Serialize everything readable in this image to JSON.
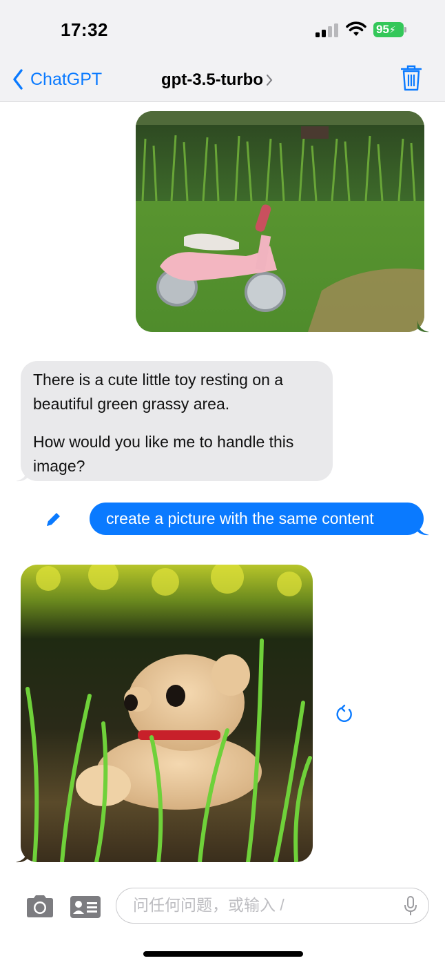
{
  "status_bar": {
    "time": "17:32",
    "battery": "95",
    "battery_color": "#34c759"
  },
  "nav": {
    "back_label": "ChatGPT",
    "title": "gpt-3.5-turbo",
    "accent_color": "#0a7aff",
    "icons": [
      "chevron-left-icon",
      "chevron-right-icon",
      "trash-icon"
    ]
  },
  "messages": [
    {
      "role": "user",
      "type": "image",
      "content": "photo of pink toddler balance bike on grass"
    },
    {
      "role": "assistant",
      "type": "text",
      "paragraphs": [
        "There is a cute little toy resting on a beautiful green grassy area.",
        "How would you like me to handle this image?"
      ]
    },
    {
      "role": "user",
      "type": "text",
      "text": "create a picture with the same content"
    },
    {
      "role": "assistant",
      "type": "image",
      "content": "generated image of a teddy bear toy in grass"
    }
  ],
  "input": {
    "placeholder": "问任何问题，或输入 /",
    "icons": [
      "camera-icon",
      "contact-card-icon",
      "microphone-icon"
    ]
  }
}
